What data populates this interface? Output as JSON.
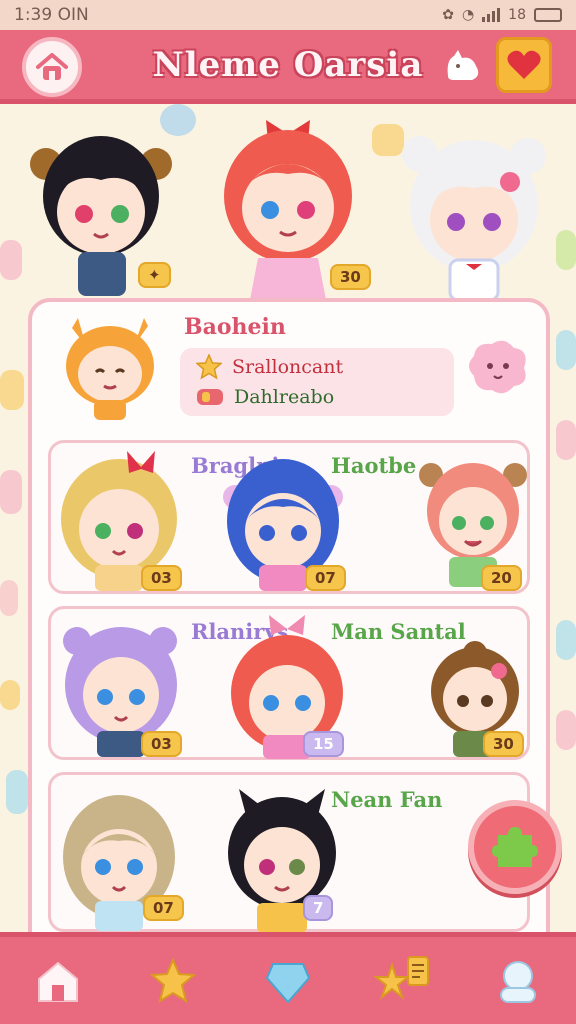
{
  "status_bar": {
    "time": "1:39 OIN",
    "right_text": "18"
  },
  "header": {
    "title": "Nleme Oarsia",
    "home_icon": "home-icon",
    "pet_icon": "cat-icon",
    "favorite_icon": "heart-icon"
  },
  "top_characters": {
    "badge": "30"
  },
  "featured": {
    "name": "Baohein",
    "stats": [
      {
        "icon": "star-icon",
        "text": "Sralloncant"
      },
      {
        "icon": "gem-icon",
        "text": "Dahlreabo"
      }
    ]
  },
  "cards": [
    {
      "labels": [
        "Braglni",
        "Haotbe"
      ],
      "badges": [
        "03",
        "07",
        "20"
      ]
    },
    {
      "labels": [
        "Rlanirys",
        "Man Santal"
      ],
      "badges": [
        "03",
        "15",
        "30"
      ]
    },
    {
      "labels": [
        "Nean Fan"
      ],
      "badges": [
        "07",
        "7"
      ]
    }
  ],
  "bottom_nav": [
    {
      "icon": "home-icon"
    },
    {
      "icon": "star-icon"
    },
    {
      "icon": "gem-icon"
    },
    {
      "icon": "star-note-icon"
    },
    {
      "icon": "profile-icon"
    }
  ],
  "colors": {
    "accent": "#e9697f",
    "background": "#fbf3e2",
    "panel_border": "#f3b9c4"
  }
}
